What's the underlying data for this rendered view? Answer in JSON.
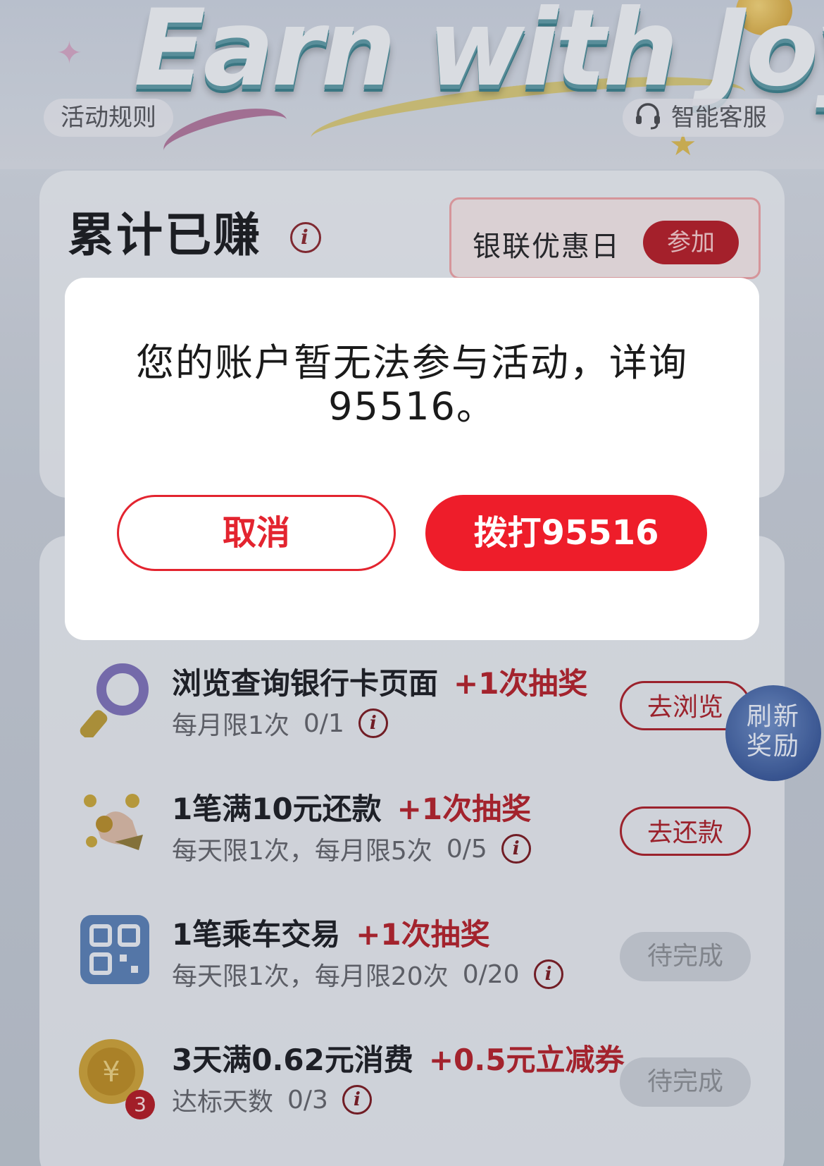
{
  "banner": {
    "title": "Earn with Joy",
    "rules_label": "活动规则",
    "service_label": "智能客服"
  },
  "earnings": {
    "title": "累计已赚",
    "event_name": "银联优惠日",
    "event_join": "参加"
  },
  "dialog": {
    "message_line1": "您的账户暂无法参与活动，详询",
    "message_line2": "95516。",
    "cancel_label": "取消",
    "call_label": "拨打95516"
  },
  "tasks": [
    {
      "title": "浏览查询银行卡页面",
      "reward": "+1次抽奖",
      "limit": "每月限1次",
      "progress": "0/1",
      "button": "去浏览",
      "button_state": "active",
      "icon": "magnifier-icon"
    },
    {
      "title": "1笔满10元还款",
      "reward": "+1次抽奖",
      "limit": "每天限1次，每月限5次",
      "progress": "0/5",
      "button": "去还款",
      "button_state": "active",
      "icon": "hand-coins-icon"
    },
    {
      "title": "1笔乘车交易",
      "reward": "+1次抽奖",
      "limit": "每天限1次，每月限20次",
      "progress": "0/20",
      "button": "待完成",
      "button_state": "pending",
      "icon": "qr-code-icon"
    },
    {
      "title": "3天满0.62元消费",
      "reward": "+0.5元立减券",
      "limit": "达标天数",
      "progress": "0/3",
      "button": "待完成",
      "button_state": "pending",
      "icon": "yuan-coin-icon",
      "badge": "3"
    }
  ],
  "refresh": {
    "line1": "刷新",
    "line2": "奖励"
  },
  "colors": {
    "accent": "#ee1d2a",
    "reward": "#b1232d"
  }
}
